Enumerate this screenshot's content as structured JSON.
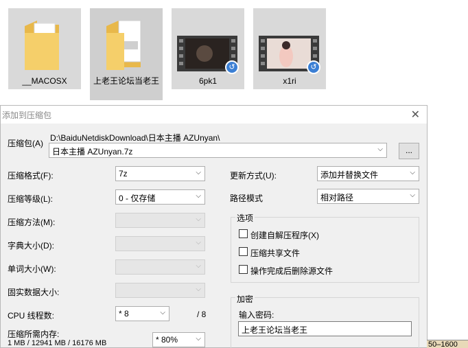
{
  "files": [
    {
      "name": "__MACOSX",
      "icon": "folder-icon"
    },
    {
      "name": "上老王论坛当老王",
      "icon": "folder-icon"
    },
    {
      "name": "6pk1",
      "icon": "video-icon"
    },
    {
      "name": "x1ri",
      "icon": "video-icon"
    }
  ],
  "dialog": {
    "title": "添加到压缩包",
    "archive_label": "压缩包(A)",
    "archive_path": "D:\\BaiduNetdiskDownload\\日本主播 AZUnyan\\",
    "archive_name": "日本主播 AZUnyan.7z",
    "browse_label": "...",
    "format_label": "压缩格式(F):",
    "format_value": "7z",
    "level_label": "压缩等级(L):",
    "level_value": "0 - 仅存储",
    "method_label": "压缩方法(M):",
    "dict_label": "字典大小(D):",
    "word_label": "单词大小(W):",
    "solid_label": "固实数据大小:",
    "threads_label": "CPU 线程数:",
    "threads_value": "* 8",
    "threads_total": "/ 8",
    "memory_label": "压缩所需内存:",
    "memory_info": "1 MB / 12941 MB / 16176 MB",
    "memory_value": "* 80%",
    "update_label": "更新方式(U):",
    "update_value": "添加并替换文件",
    "path_label": "路径模式",
    "path_value": "相对路径",
    "options_title": "选项",
    "opt_sfx": "创建自解压程序(X)",
    "opt_shared": "压缩共享文件",
    "opt_delete": "操作完成后删除源文件",
    "encrypt_title": "加密",
    "password_label": "输入密码:",
    "password_value": "上老王论坛当老王"
  },
  "corner_text": "50–1600"
}
